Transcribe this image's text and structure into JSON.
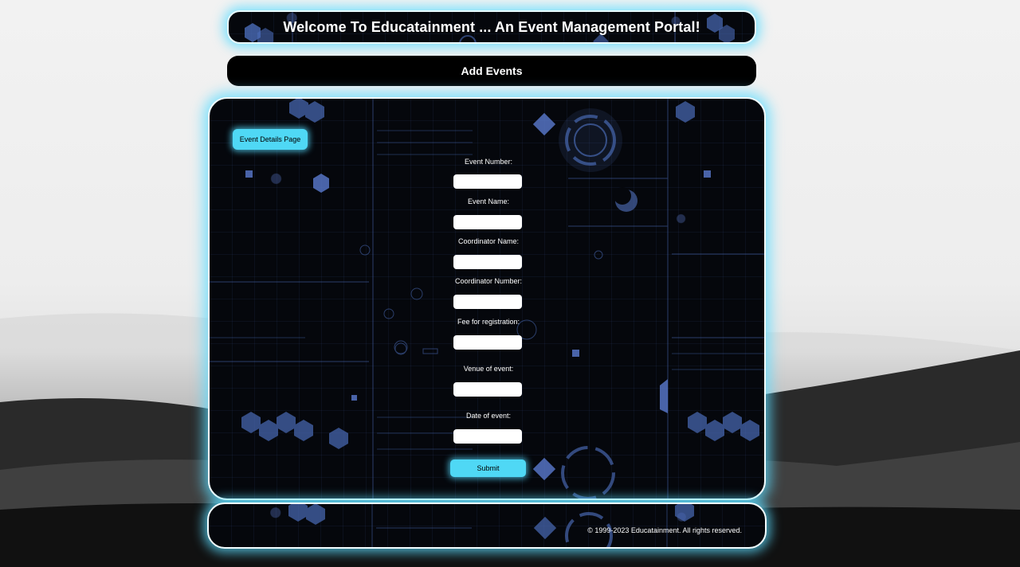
{
  "header": {
    "title": "Welcome To Educatainment ... An Event Management Portal!"
  },
  "nav": {
    "add_events": "Add Events"
  },
  "panel": {
    "badge": "Event Details Page",
    "fields": [
      {
        "label": "Event Number:",
        "value": ""
      },
      {
        "label": "Event Name:",
        "value": ""
      },
      {
        "label": "Coordinator Name:",
        "value": ""
      },
      {
        "label": "Coordinator Number:",
        "value": ""
      },
      {
        "label": "Fee for registration:",
        "value": ""
      },
      {
        "label": "Venue of event:",
        "value": ""
      },
      {
        "label": "Date of event:",
        "value": ""
      }
    ],
    "submit_label": "Submit"
  },
  "footer": {
    "copyright": "© 1999-2023 Educatainment. All rights reserved."
  },
  "colors": {
    "accent": "#4fd8f5",
    "glow": "#5cdcff",
    "panel_bg": "#05070c",
    "text": "#ffffff"
  }
}
